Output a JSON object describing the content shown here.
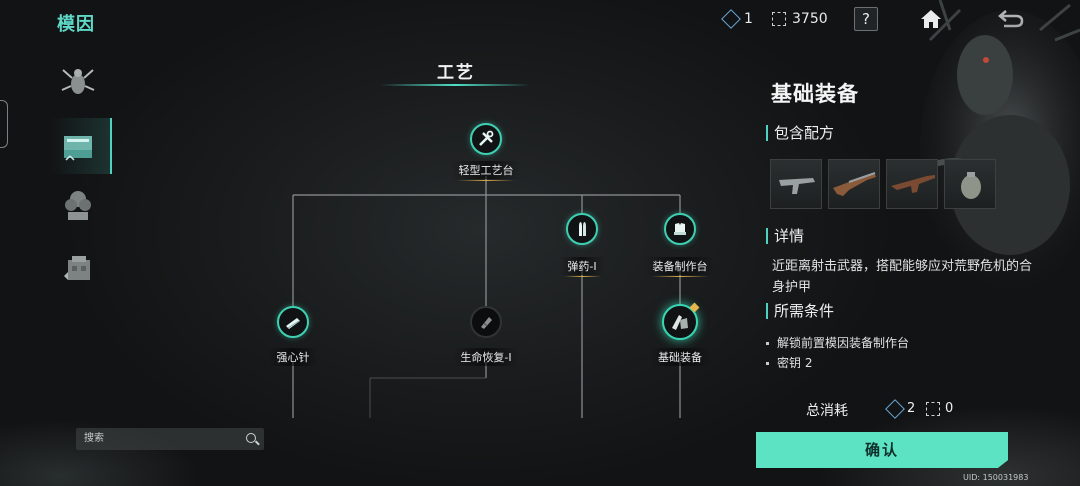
{
  "topbar": {
    "title": "模因",
    "resource_key": {
      "icon": "gene-key-icon",
      "value": "1"
    },
    "resource_points": {
      "icon": "gene-point-icon",
      "value": "3750"
    },
    "help_label": "?"
  },
  "sidebar": {
    "tabs": [
      {
        "name": "insect-tab",
        "active": false
      },
      {
        "name": "craft-tab",
        "active": true
      },
      {
        "name": "tree-tab",
        "active": false
      },
      {
        "name": "building-tab",
        "active": false
      }
    ]
  },
  "tree": {
    "title": "工艺",
    "nodes": [
      {
        "id": "light-workbench",
        "label": "轻型工艺台",
        "state": "unlocked"
      },
      {
        "id": "ammo-1",
        "label": "弹药-I",
        "state": "unlocked"
      },
      {
        "id": "equipment-workbench",
        "label": "装备制作台",
        "state": "unlocked"
      },
      {
        "id": "adrenaline",
        "label": "强心针",
        "state": "unlocked"
      },
      {
        "id": "life-recovery-1",
        "label": "生命恢复-I",
        "state": "locked"
      },
      {
        "id": "basic-equipment",
        "label": "基础装备",
        "state": "selected"
      }
    ]
  },
  "search": {
    "placeholder": "搜索"
  },
  "detail_panel": {
    "title": "基础装备",
    "recipes_heading": "包含配方",
    "recipes": [
      "smg",
      "shotgun",
      "rifle",
      "grenade"
    ],
    "details_heading": "详情",
    "details_text": "近距离射击武器，搭配能够应对荒野危机的合身护甲",
    "requirements_heading": "所需条件",
    "requirements": [
      "解锁前置模因装备制作台",
      "密钥 2"
    ],
    "total_cost_label": "总消耗",
    "cost_key": "2",
    "cost_points": "0",
    "confirm_label": "确认"
  },
  "uid": "UID: 150031983",
  "colors": {
    "accent": "#5ce3c4",
    "node_ring": "#3fcfb3",
    "gold": "#d9a945"
  }
}
